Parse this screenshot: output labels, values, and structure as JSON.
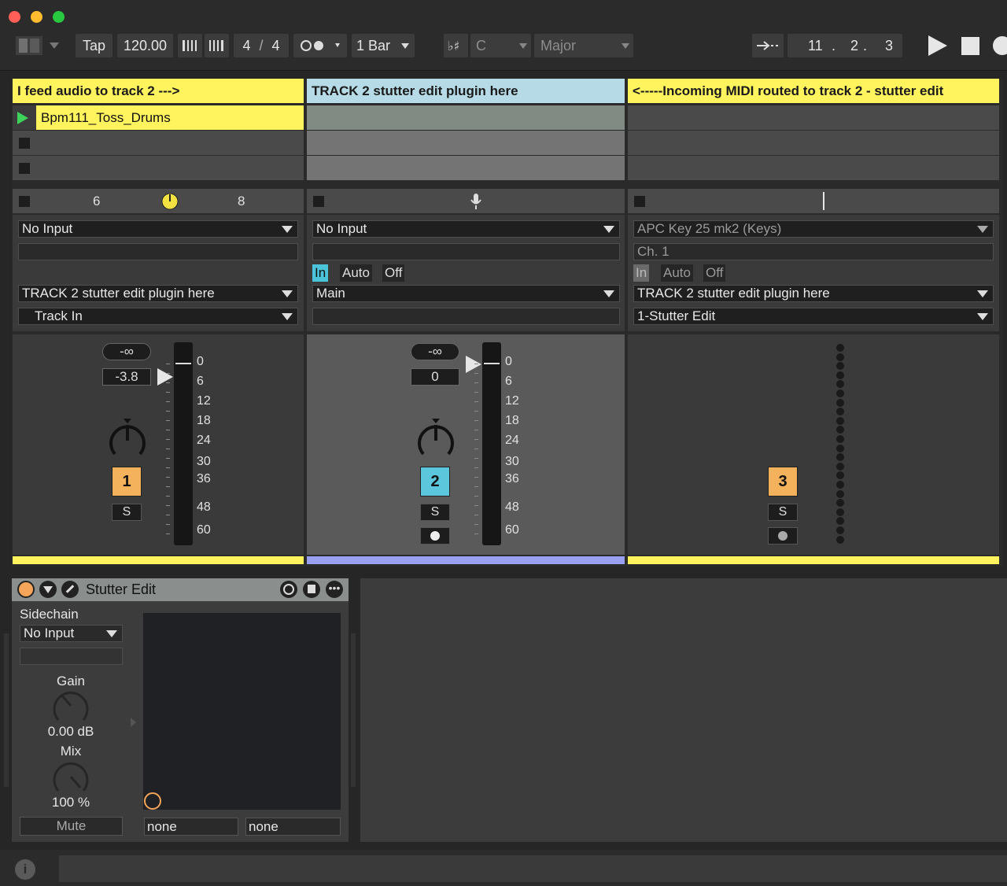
{
  "transport": {
    "tap": "Tap",
    "tempo": "120.00",
    "sig_num": "4",
    "sig_slash": "/",
    "sig_den": "4",
    "quantize": "1 Bar",
    "key": "C",
    "scale": "Major",
    "position": [
      "11",
      "2",
      "3"
    ]
  },
  "tracks": [
    {
      "name": "I feed audio to track 2 --->",
      "color": "#fff45e",
      "clip": "Bpm111_Toss_Drums",
      "top_num_a": "6",
      "top_num_b": "8",
      "input": "No Input",
      "output": "TRACK 2 stutter edit plugin here",
      "output_sub": "Track In",
      "volume_inf": "-∞",
      "volume": "-3.8",
      "number": "1",
      "solo": "S"
    },
    {
      "name": "TRACK 2 stutter edit plugin here",
      "color": "#b6dbe6",
      "input": "No Input",
      "monitor": [
        "In",
        "Auto",
        "Off"
      ],
      "output": "Main",
      "volume_inf": "-∞",
      "volume": "0",
      "number": "2",
      "solo": "S"
    },
    {
      "name": "<-----Incoming MIDI routed to track 2 - stutter edit",
      "color": "#fff45e",
      "input": "APC Key 25 mk2 (Keys)",
      "channel": "Ch. 1",
      "monitor": [
        "In",
        "Auto",
        "Off"
      ],
      "output": "TRACK 2 stutter edit plugin here",
      "output_sub": "1-Stutter Edit",
      "number": "3",
      "solo": "S"
    }
  ],
  "meter_scale": [
    "0",
    "6",
    "12",
    "18",
    "24",
    "30",
    "36",
    "48",
    "60"
  ],
  "device": {
    "title": "Stutter Edit",
    "sidechain": "Sidechain",
    "sidechain_input": "No Input",
    "gain_label": "Gain",
    "gain_value": "0.00 dB",
    "mix_label": "Mix",
    "mix_value": "100 %",
    "mute": "Mute",
    "slot_a": "none",
    "slot_b": "none"
  }
}
